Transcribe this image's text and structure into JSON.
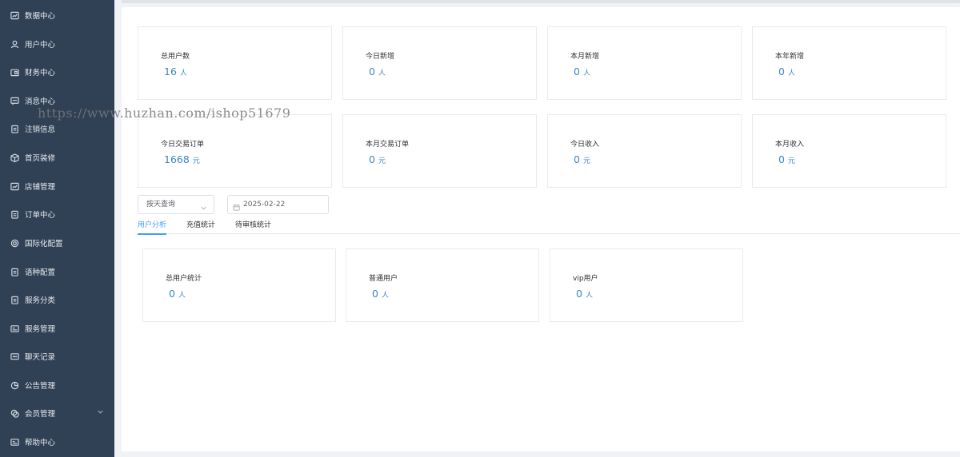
{
  "sidebar": {
    "items": [
      {
        "label": "数据中心",
        "icon": "chart-icon"
      },
      {
        "label": "用户中心",
        "icon": "user-icon"
      },
      {
        "label": "财务中心",
        "icon": "wallet-icon"
      },
      {
        "label": "消息中心",
        "icon": "message-icon"
      },
      {
        "label": "注销信息",
        "icon": "clipboard-icon"
      },
      {
        "label": "首页装修",
        "icon": "box-icon"
      },
      {
        "label": "店铺管理",
        "icon": "chart-icon"
      },
      {
        "label": "订单中心",
        "icon": "clipboard-icon"
      },
      {
        "label": "国际化配置",
        "icon": "gear-icon"
      },
      {
        "label": "语种配置",
        "icon": "clipboard-icon"
      },
      {
        "label": "服务分类",
        "icon": "clipboard-icon"
      },
      {
        "label": "服务管理",
        "icon": "card-icon"
      },
      {
        "label": "聊天记录",
        "icon": "chat-icon"
      },
      {
        "label": "公告管理",
        "icon": "pie-icon"
      },
      {
        "label": "会员管理",
        "icon": "coins-icon",
        "has_chevron": true
      },
      {
        "label": "帮助中心",
        "icon": "card-icon"
      }
    ]
  },
  "stats_row1": [
    {
      "label": "总用户数",
      "value": "16",
      "unit": "人"
    },
    {
      "label": "今日新增",
      "value": "0",
      "unit": "人"
    },
    {
      "label": "本月新增",
      "value": "0",
      "unit": "人"
    },
    {
      "label": "本年新增",
      "value": "0",
      "unit": "人"
    }
  ],
  "stats_row2": [
    {
      "label": "今日交易订单",
      "value": "1668",
      "unit": "元"
    },
    {
      "label": "本月交易订单",
      "value": "0",
      "unit": "元"
    },
    {
      "label": "今日收入",
      "value": "0",
      "unit": "元"
    },
    {
      "label": "本月收入",
      "value": "0",
      "unit": "元"
    }
  ],
  "filter": {
    "query_mode": "按天查询",
    "date": "2025-02-22"
  },
  "tabs": [
    {
      "label": "用户分析",
      "active": true
    },
    {
      "label": "充值统计",
      "active": false
    },
    {
      "label": "待审核统计",
      "active": false
    }
  ],
  "user_stats": [
    {
      "label": "总用户统计",
      "value": "0",
      "unit": "人"
    },
    {
      "label": "普通用户",
      "value": "0",
      "unit": "人"
    },
    {
      "label": "vip用户",
      "value": "0",
      "unit": "人"
    }
  ],
  "watermark": "https://www.huzhan.com/ishop51679",
  "colors": {
    "sidebar_bg": "#304156",
    "accent": "#409eff",
    "value": "#3c86c7"
  }
}
